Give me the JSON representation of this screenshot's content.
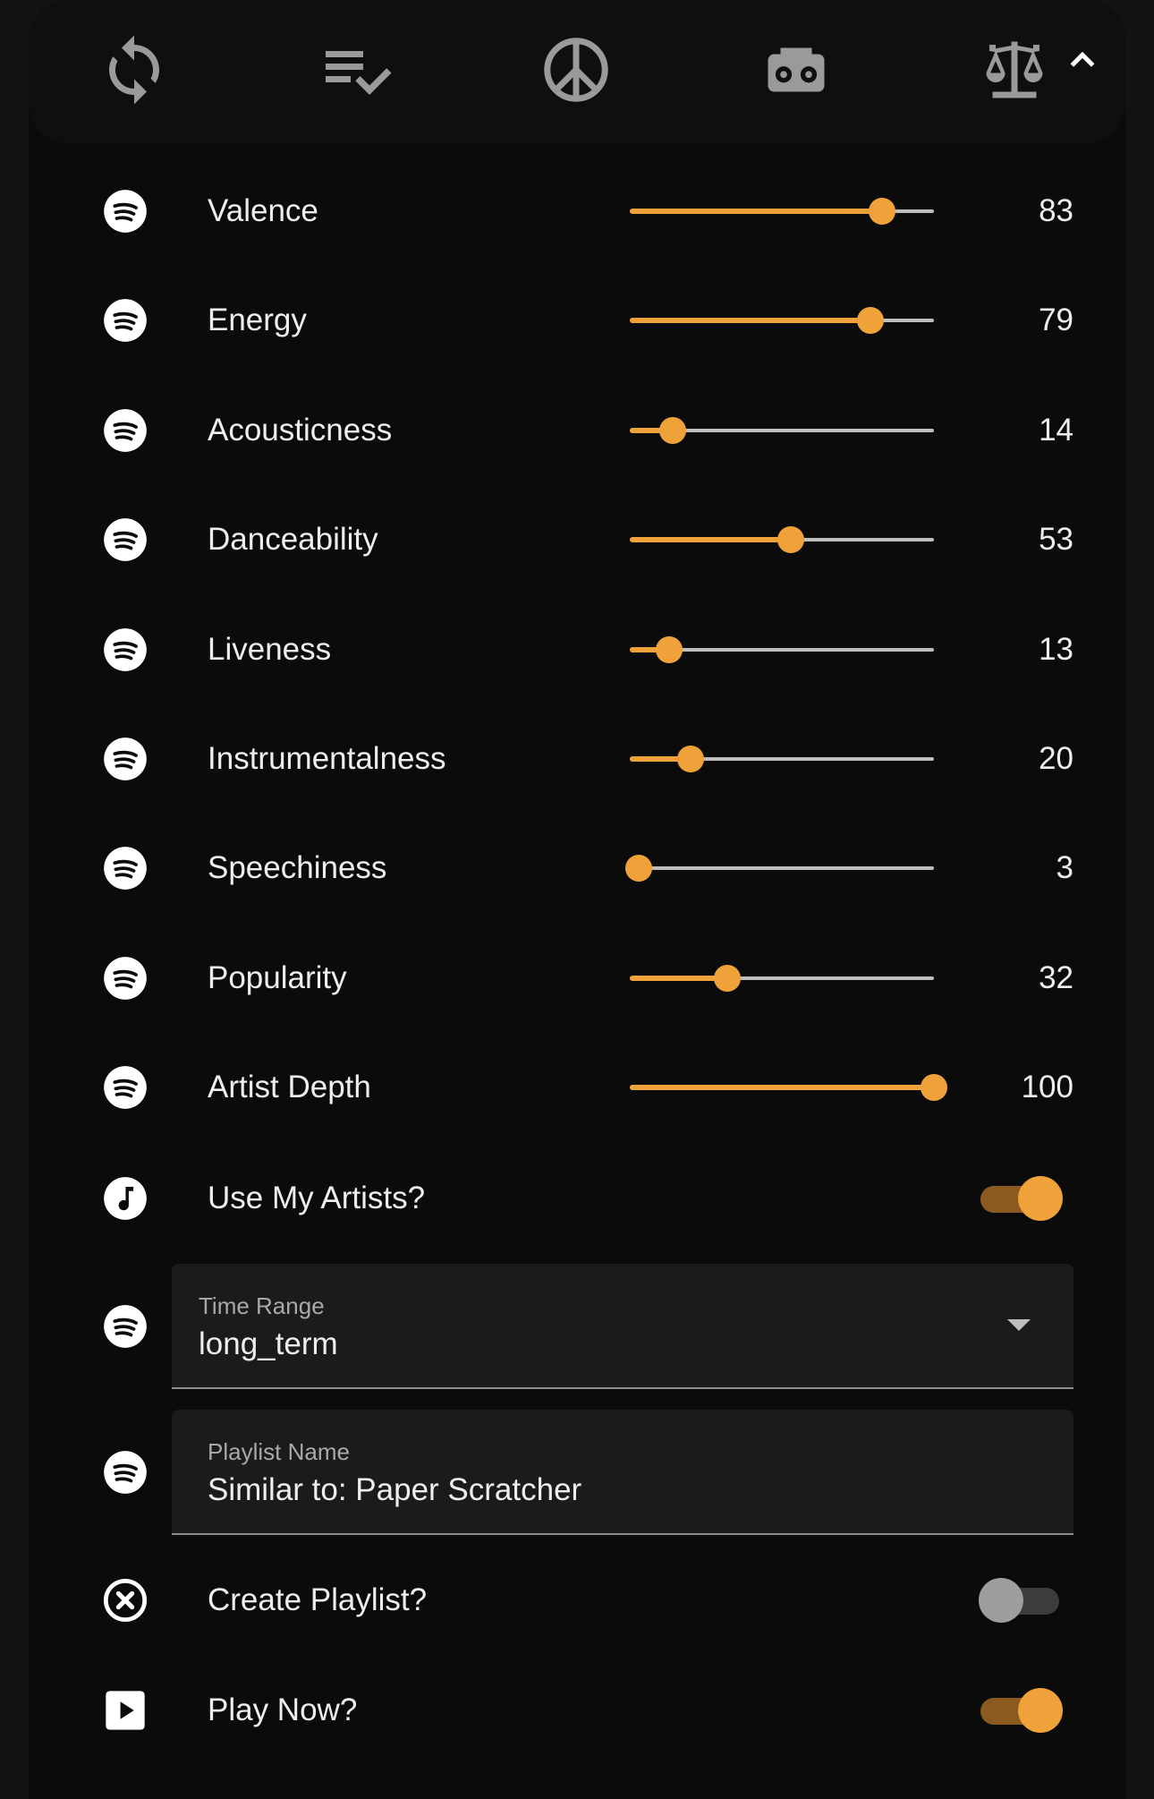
{
  "colors": {
    "accent": "#f0a23a",
    "accent_dim": "#8a5a20",
    "track": "#bdbdbd",
    "background": "#0b0b0b",
    "icon_gray": "#9a9a9a"
  },
  "toolbar": {
    "icons": [
      "refresh-icon",
      "playlist-check-icon",
      "peace-icon",
      "radio-icon",
      "scale-balance-icon",
      "chevron-up-icon"
    ]
  },
  "sliders": [
    {
      "label": "Valence",
      "value": "83",
      "level": 0.83,
      "icon": "spotify-icon"
    },
    {
      "label": "Energy",
      "value": "79",
      "level": 0.79,
      "icon": "spotify-icon"
    },
    {
      "label": "Acousticness",
      "value": "14",
      "level": 0.14,
      "icon": "spotify-icon"
    },
    {
      "label": "Danceability",
      "value": "53",
      "level": 0.53,
      "icon": "spotify-icon"
    },
    {
      "label": "Liveness",
      "value": "13",
      "level": 0.13,
      "icon": "spotify-icon"
    },
    {
      "label": "Instrumentalness",
      "value": "20",
      "level": 0.2,
      "icon": "spotify-icon"
    },
    {
      "label": "Speechiness",
      "value": "3",
      "level": 0.03,
      "icon": "spotify-icon"
    },
    {
      "label": "Popularity",
      "value": "32",
      "level": 0.32,
      "icon": "spotify-icon"
    },
    {
      "label": "Artist Depth",
      "value": "100",
      "level": 1.0,
      "icon": "spotify-icon"
    }
  ],
  "use_my_artists": {
    "label": "Use My Artists?",
    "on": true,
    "icon": "music-note-icon"
  },
  "time_range": {
    "label": "Time Range",
    "value": "long_term",
    "icon": "spotify-icon"
  },
  "playlist_name": {
    "label": "Playlist Name",
    "value": "Similar to: Paper Scratcher",
    "icon": "spotify-icon"
  },
  "create_playlist": {
    "label": "Create Playlist?",
    "on": false,
    "icon": "close-circle-icon"
  },
  "play_now": {
    "label": "Play Now?",
    "on": true,
    "icon": "play-box-icon"
  }
}
